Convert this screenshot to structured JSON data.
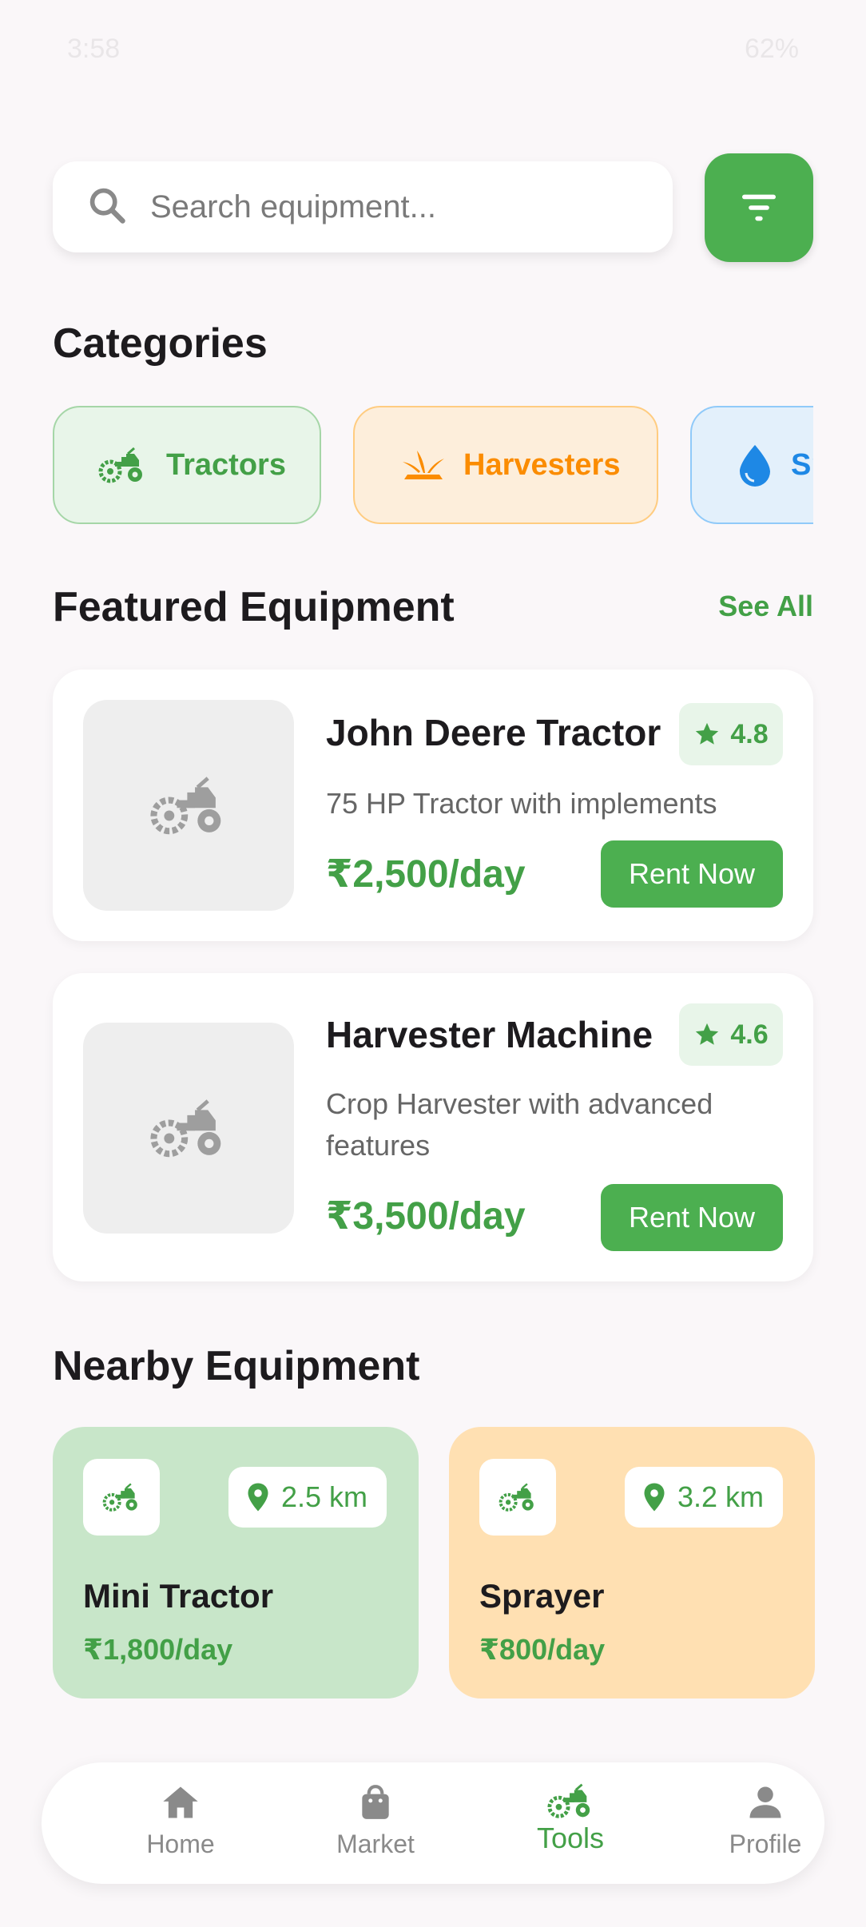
{
  "status_bar": {
    "time": "3:58",
    "battery": "62%"
  },
  "search": {
    "placeholder": "Search equipment..."
  },
  "sections": {
    "categories": "Categories",
    "featured": "Featured Equipment",
    "see_all": "See All",
    "nearby": "Nearby Equipment"
  },
  "categories": [
    {
      "label": "Tractors",
      "icon": "tractor-icon",
      "bg": "#e8f5e9",
      "border": "#a5d6a7",
      "color": "#43a047"
    },
    {
      "label": "Harvesters",
      "icon": "harvest-icon",
      "bg": "#fdeedb",
      "border": "#ffcc80",
      "color": "#fb8c00"
    },
    {
      "label": "Sprayers",
      "icon": "water-drop-icon",
      "bg": "#e3f0fb",
      "border": "#90caf9",
      "color": "#1e88e5"
    }
  ],
  "featured": [
    {
      "title": "John Deere Tractor",
      "rating": "4.8",
      "desc": "75 HP Tractor with implements",
      "price": "₹2,500/day",
      "button": "Rent Now"
    },
    {
      "title": "Harvester Machine",
      "rating": "4.6",
      "desc": "Crop Harvester with advanced features",
      "price": "₹3,500/day",
      "button": "Rent Now"
    }
  ],
  "nearby": [
    {
      "title": "Mini Tractor",
      "price": "₹1,800/day",
      "distance": "2.5 km",
      "bg": "#c8e6c9"
    },
    {
      "title": "Sprayer",
      "price": "₹800/day",
      "distance": "3.2 km",
      "bg": "#ffe0b2"
    }
  ],
  "nav": [
    {
      "label": "Home",
      "icon": "home-icon"
    },
    {
      "label": "Market",
      "icon": "shopping-bag-icon"
    },
    {
      "label": "Tools",
      "icon": "tractor-icon",
      "active": true
    },
    {
      "label": "Profile",
      "icon": "person-icon"
    }
  ],
  "colors": {
    "accent": "#4caf50",
    "accent_text": "#43a047",
    "background": "#faf7f9"
  }
}
